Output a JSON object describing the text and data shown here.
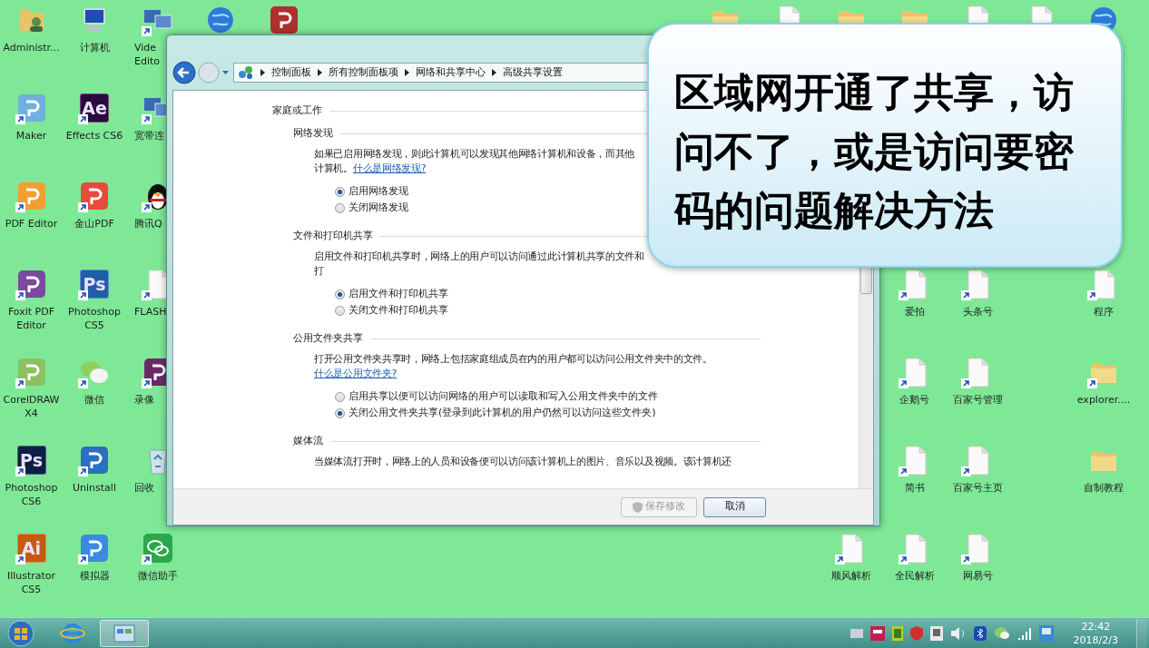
{
  "desktop_icons": [
    {
      "label": "Administr...",
      "kind": "user-folder",
      "shortcut": false,
      "covered": false
    },
    {
      "label": "计算机",
      "kind": "computer",
      "shortcut": false,
      "covered": false
    },
    {
      "label": "Vide Edito",
      "kind": "monitors",
      "shortcut": true,
      "covered": true
    },
    {
      "kind": "globe",
      "shortcut": false
    },
    {
      "kind": "tile",
      "color": "#b03030",
      "shortcut": false
    },
    {
      "kind": "folder"
    },
    {
      "kind": "document"
    },
    {
      "kind": "folder"
    },
    {
      "kind": "folder"
    },
    {
      "kind": "document"
    },
    {
      "kind": "document"
    },
    {
      "kind": "globe"
    },
    {
      "label": "Maker",
      "kind": "tile",
      "color": "#6fb0e0",
      "shortcut": true,
      "covered": false
    },
    {
      "label": "Effects CS6",
      "kind": "tile",
      "color": "#2a0a3f",
      "badge": "Ae",
      "shortcut": true,
      "covered": false
    },
    {
      "label": "宽带连",
      "kind": "monitors",
      "shortcut": true,
      "covered": true
    },
    {
      "label": "PDF Editor",
      "kind": "tile",
      "color": "#f0a030",
      "shortcut": true,
      "covered": false
    },
    {
      "label": "金山PDF",
      "kind": "tile",
      "color": "#e84a3c",
      "shortcut": true,
      "covered": false
    },
    {
      "label": "腾讯Q",
      "kind": "penguin",
      "shortcut": true,
      "covered": true
    },
    {
      "label": "Foxit PDF Editor",
      "kind": "tile",
      "color": "#7a4aa0",
      "shortcut": true,
      "covered": false
    },
    {
      "label": "Photoshop CS5",
      "kind": "tile",
      "color": "#1f5fa8",
      "badge": "Ps",
      "shortcut": true,
      "covered": false
    },
    {
      "label": "FLASH",
      "kind": "document",
      "shortcut": true,
      "covered": true
    },
    {
      "label": "CorelDRAW X4",
      "kind": "tile",
      "color": "#8cc060",
      "shortcut": true,
      "covered": false
    },
    {
      "label": "微信",
      "kind": "chat",
      "shortcut": true,
      "covered": false
    },
    {
      "label": "录像",
      "kind": "tile",
      "color": "#6a2a6a",
      "shortcut": true,
      "covered": true
    },
    {
      "label": "Photoshop CS6",
      "kind": "tile",
      "color": "#0c1f44",
      "badge": "Ps",
      "shortcut": true,
      "covered": false
    },
    {
      "label": "Uninstall",
      "kind": "tile",
      "color": "#2a70c0",
      "shortcut": true,
      "covered": false
    },
    {
      "label": "回收",
      "kind": "recycle",
      "shortcut": false,
      "covered": true
    },
    {
      "label": "Illustrator CS5",
      "kind": "tile",
      "color": "#c65a10",
      "badge": "Ai",
      "shortcut": true,
      "covered": false
    },
    {
      "label": "模拟器",
      "kind": "tile",
      "color": "#3a8ae0",
      "shortcut": true,
      "covered": false
    },
    {
      "label": "微信助手",
      "kind": "chat-tile",
      "shortcut": true,
      "covered": false
    },
    {
      "label": "爱拍",
      "kind": "document",
      "shortcut": true,
      "covered": false
    },
    {
      "label": "头条号",
      "kind": "document",
      "shortcut": true,
      "covered": false
    },
    {
      "label": "程序",
      "kind": "document",
      "shortcut": true,
      "covered": false
    },
    {
      "label": "企鹅号",
      "kind": "document",
      "shortcut": true,
      "covered": false
    },
    {
      "label": "百家号管理",
      "kind": "document",
      "shortcut": true,
      "covered": false
    },
    {
      "label": "explorer....",
      "kind": "folder",
      "shortcut": true,
      "covered": false
    },
    {
      "label": "简书",
      "kind": "document",
      "shortcut": true,
      "covered": false
    },
    {
      "label": "百家号主页",
      "kind": "document",
      "shortcut": true,
      "covered": false
    },
    {
      "label": "自制教程",
      "kind": "folder",
      "shortcut": false,
      "covered": false
    },
    {
      "label": "顺风解析",
      "kind": "document",
      "shortcut": true,
      "covered": false
    },
    {
      "label": "全民解析",
      "kind": "document",
      "shortcut": true,
      "covered": false
    },
    {
      "label": "网易号",
      "kind": "document",
      "shortcut": true,
      "covered": false
    }
  ],
  "window": {
    "breadcrumbs": [
      "控制面板",
      "所有控制面板项",
      "网络和共享中心",
      "高级共享设置"
    ],
    "sections": [
      {
        "heading": "家庭或工作",
        "groups": [
          {
            "heading": "网络发现",
            "description": "如果已启用网络发现，则此计算机可以发现其他网络计算机和设备，而其他计算机。",
            "link": "什么是网络发现?",
            "options": [
              {
                "label": "启用网络发现",
                "selected": true
              },
              {
                "label": "关闭网络发现",
                "selected": false
              }
            ]
          },
          {
            "heading": "文件和打印机共享",
            "description": "启用文件和打印机共享时，网络上的用户可以访问通过此计算机共享的文件和打",
            "options": [
              {
                "label": "启用文件和打印机共享",
                "selected": true
              },
              {
                "label": "关闭文件和打印机共享",
                "selected": false
              }
            ]
          },
          {
            "heading": "公用文件夹共享",
            "description": "打开公用文件夹共享时，网络上包括家庭组成员在内的用户都可以访问公用文件夹中的文件。",
            "link": "什么是公用文件夹?",
            "options": [
              {
                "label": "启用共享以便可以访问网络的用户可以读取和写入公用文件夹中的文件",
                "selected": false
              },
              {
                "label": "关闭公用文件夹共享(登录到此计算机的用户仍然可以访问这些文件夹)",
                "selected": true
              }
            ]
          },
          {
            "heading": "媒体流",
            "description": "当媒体流打开时，网络上的人员和设备便可以访问该计算机上的图片、音乐以及视频。该计算机还"
          }
        ]
      }
    ],
    "buttons": [
      {
        "label": "保存修改",
        "disabled": true
      },
      {
        "label": "取消",
        "disabled": false
      }
    ]
  },
  "callout": {
    "text": "区域网开通了共享，访问不了，或是访问要密码的问题解决方法"
  },
  "taskbar": {
    "apps": [
      {
        "kind": "browser",
        "selected": false
      },
      {
        "kind": "control-panel",
        "selected": true
      }
    ],
    "clock": {
      "time": "22:42",
      "date": "2018/2/3"
    }
  }
}
